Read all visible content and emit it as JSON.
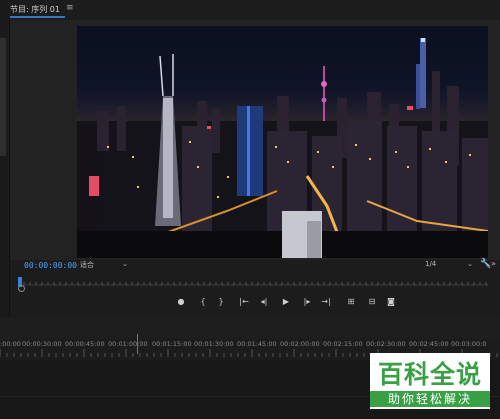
{
  "panel": {
    "title": "节目: 序列 01",
    "menu_glyph": "≡"
  },
  "viewer": {
    "timecode": "00:00:00:00",
    "fit_label": "适合",
    "resolution_label": "1/4",
    "dropdown_glyph": "⌄"
  },
  "transport": [
    {
      "name": "add-marker-icon",
      "glyph": "●"
    },
    {
      "name": "mark-in-icon",
      "glyph": "{"
    },
    {
      "name": "mark-out-icon",
      "glyph": "}"
    },
    {
      "name": "go-to-in-icon",
      "glyph": "|←"
    },
    {
      "name": "step-back-icon",
      "glyph": "◂|"
    },
    {
      "name": "play-icon",
      "glyph": "▶"
    },
    {
      "name": "step-forward-icon",
      "glyph": "|▸"
    },
    {
      "name": "go-to-out-icon",
      "glyph": "→|"
    },
    {
      "name": "insert-icon",
      "glyph": "⊞"
    },
    {
      "name": "overwrite-icon",
      "glyph": "⊟"
    },
    {
      "name": "export-frame-icon",
      "glyph": "◙"
    }
  ],
  "timeline": {
    "ruler": [
      ":00:00",
      "00:00:30:00",
      "00:00:45:00",
      "00:01:00:00",
      "00:01:15:00",
      "00:01:30:00",
      "00:01:45:00",
      "00:02:00:00",
      "00:02:15:00",
      "00:02:30:00",
      "00:02:45:00",
      "00:03:00:0"
    ]
  },
  "watermark": {
    "main": "百科全说",
    "sub": "助你轻松解决"
  },
  "colors": {
    "accent": "#3b73c9",
    "timecode": "#4aa3ff",
    "watermark_green": "#3aa046"
  }
}
